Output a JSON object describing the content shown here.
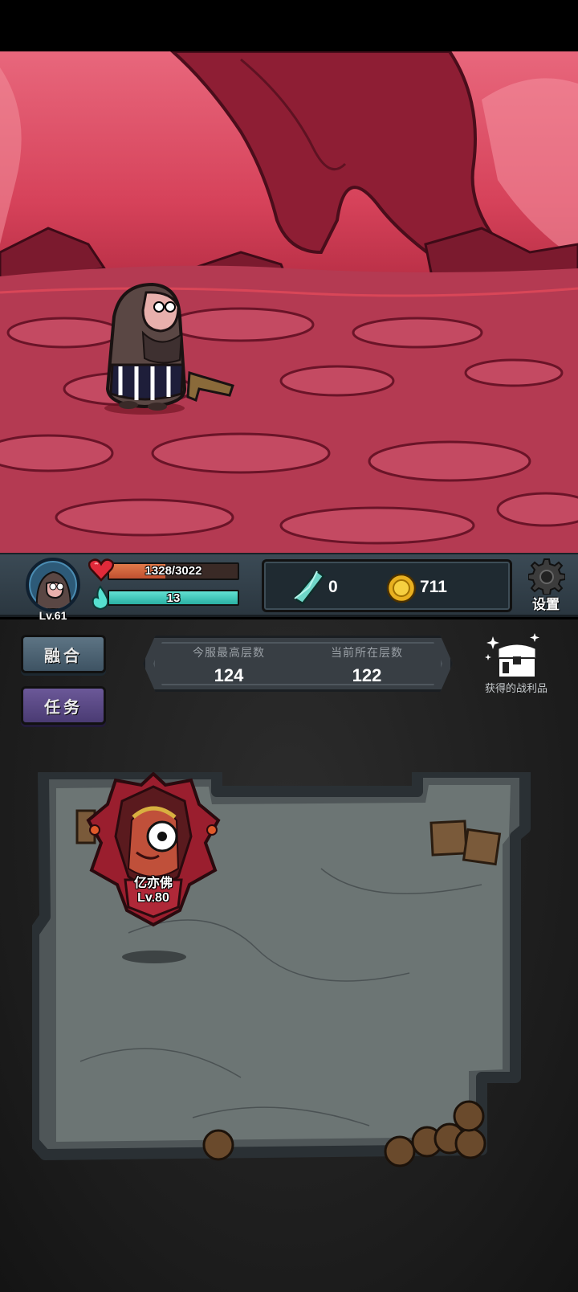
{
  "player": {
    "level": "Lv.61",
    "hp_text": "1328/3022",
    "hp_fraction": 0.44,
    "mp_text": "13",
    "mp_fraction": 1.0
  },
  "currency": {
    "gems": "0",
    "coins": "711"
  },
  "settings": {
    "label": "设置"
  },
  "buttons": {
    "fusion": "融合",
    "task": "任务"
  },
  "floors": {
    "best_label": "今服最高层数",
    "best_value": "124",
    "current_label": "当前所在层数",
    "current_value": "122"
  },
  "loot": {
    "label": "获得的战利品"
  },
  "boss": {
    "name": "亿亦佛",
    "level": "Lv.80"
  },
  "colors": {
    "hp": "#d05a38",
    "mp": "#3fc8ba",
    "scene_sky": "#e8677c",
    "scene_ground": "#b0304a"
  },
  "icons": [
    "heart-icon",
    "flame-icon",
    "gem-icon",
    "coin-icon",
    "gear-icon",
    "chest-icon",
    "barrel-icon",
    "crate-icon"
  ]
}
